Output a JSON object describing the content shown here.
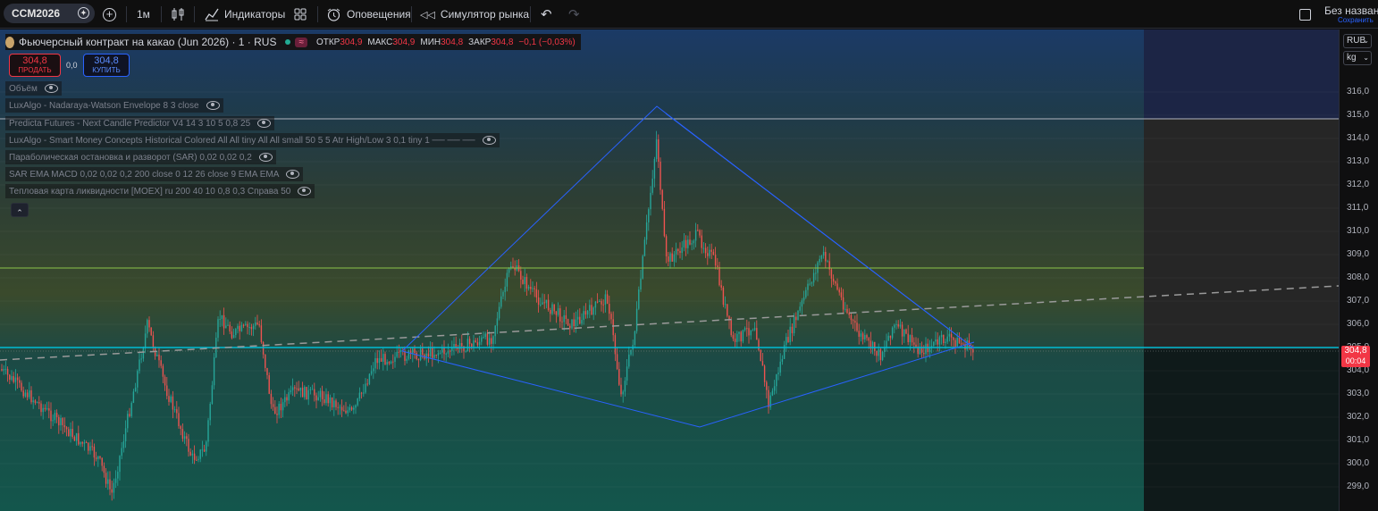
{
  "toolbar": {
    "symbol": "CCM2026",
    "interval": "1м",
    "indicators_label": "Индикаторы",
    "alerts_label": "Оповещения",
    "replay_label": "Симулятор рынка",
    "layout_name": "Без названи",
    "save_label": "Сохранить"
  },
  "legend": {
    "title": "Фьючерсный контракт на какао (Jun 2026) · 1 · RUS",
    "open_label": "ОТКР",
    "open_value": "304,9",
    "high_label": "МАКС",
    "high_value": "304,9",
    "low_label": "МИН",
    "low_value": "304,8",
    "close_label": "ЗАКР",
    "close_value": "304,8",
    "change": "−0,1 (−0,03%)"
  },
  "trade": {
    "sell_price": "304,8",
    "sell_label": "ПРОДАТЬ",
    "spread": "0,0",
    "buy_price": "304,8",
    "buy_label": "КУПИТЬ"
  },
  "indicators": [
    "Объём",
    "LuxAlgo - Nadaraya-Watson Envelope 8 3 close",
    "Predicta Futures - Next Candle Predictor V4 14 3 10 5 0,8 25",
    "LuxAlgo - Smart Money Concepts Historical Colored All All tiny All All small 50 5 5 Atr High/Low 3 0,1 tiny 1 ── ── ──",
    "Параболическая остановка и разворот (SAR) 0,02 0,02 0,2",
    "SAR EMA MACD 0,02 0,02 0,2 200 close 0 12 26 close 9 EMA EMA",
    "Тепловая карта ликвидности [MOEX] ru 200 40 10 0,8 0,3 Справа 50"
  ],
  "axis": {
    "currency": "RUB",
    "unit": "kg",
    "ticks": [
      "316,0",
      "315,0",
      "314,0",
      "313,0",
      "312,0",
      "311,0",
      "310,0",
      "309,0",
      "308,0",
      "307,0",
      "306,0",
      "305,0",
      "304,0",
      "303,0",
      "302,0",
      "301,0",
      "300,0",
      "299,0"
    ],
    "last_price": "304,8",
    "countdown": "00:04"
  },
  "colors": {
    "up": "#26a69a",
    "down": "#ef5350",
    "pattern_line": "#2962ff",
    "price_line": "#00bcd4",
    "last_price_bg": "#f23645"
  }
}
